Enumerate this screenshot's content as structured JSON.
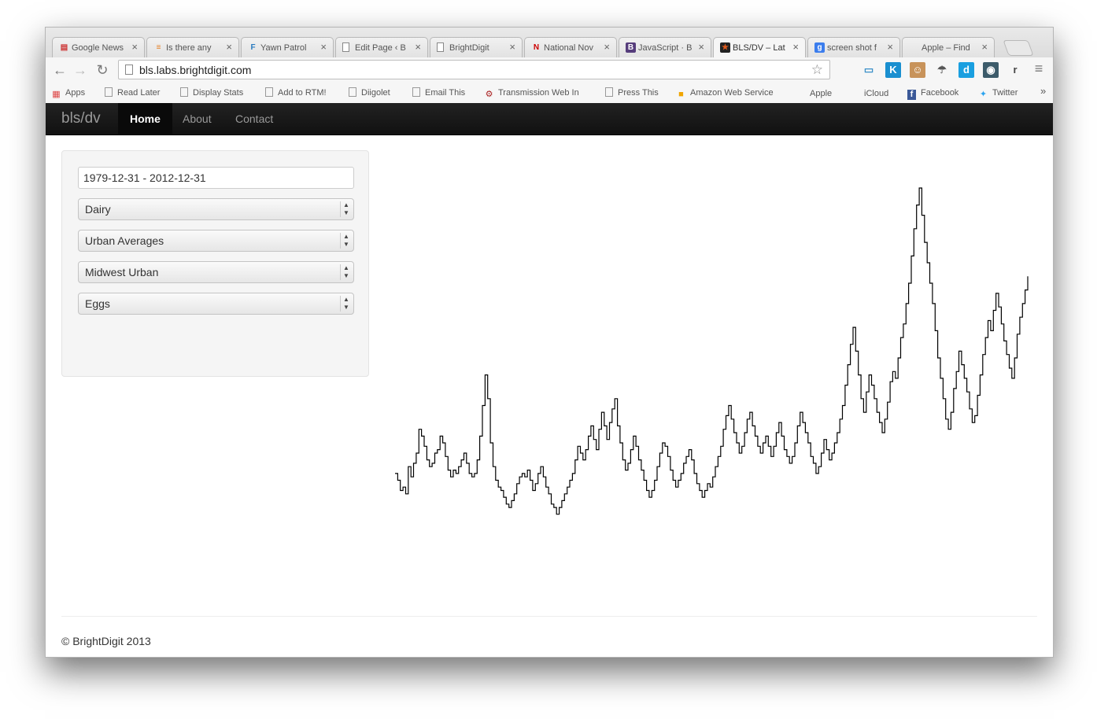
{
  "browser": {
    "tabs": [
      {
        "icon": "news-icon",
        "label": "Google News"
      },
      {
        "icon": "stackoverflow-icon",
        "label": "Is there any"
      },
      {
        "icon": "fth-icon",
        "label": "Yawn Patrol"
      },
      {
        "icon": "page-icon",
        "label": "Edit Page ‹ B"
      },
      {
        "icon": "page-icon",
        "label": "BrightDigit"
      },
      {
        "icon": "n-logo-icon",
        "label": "National Nov"
      },
      {
        "icon": "bootstrap-icon",
        "label": "JavaScript · B"
      },
      {
        "icon": "star-icon",
        "label": "BLS/DV – Lat"
      },
      {
        "icon": "google-icon",
        "label": "screen shot f"
      },
      {
        "icon": "apple-icon",
        "label": "Apple – Find"
      }
    ],
    "active_tab": 7,
    "url": "bls.labs.brightdigit.com",
    "bookmarks": [
      {
        "icon": "apps-grid-icon",
        "label": "Apps"
      },
      {
        "icon": "page-icon",
        "label": "Read Later"
      },
      {
        "icon": "page-icon",
        "label": "Display Stats"
      },
      {
        "icon": "page-icon",
        "label": "Add to RTM!"
      },
      {
        "icon": "page-icon",
        "label": "Diigolet"
      },
      {
        "icon": "page-icon",
        "label": "Email This"
      },
      {
        "icon": "transmission-icon",
        "label": "Transmission Web In"
      },
      {
        "icon": "page-icon",
        "label": "Press This"
      },
      {
        "icon": "amazon-icon",
        "label": "Amazon Web Service"
      },
      {
        "icon": "apple-icon",
        "label": "Apple"
      },
      {
        "icon": "apple-icon",
        "label": "iCloud"
      },
      {
        "icon": "facebook-icon",
        "label": "Facebook"
      },
      {
        "icon": "twitter-icon",
        "label": "Twitter"
      }
    ],
    "bookmarks_overflow": "»",
    "extensions": [
      {
        "name": "cast-icon",
        "glyph": "▭"
      },
      {
        "name": "k-extension-icon",
        "glyph": "K"
      },
      {
        "name": "character-extension-icon",
        "glyph": "☺"
      },
      {
        "name": "umbrella-extension-icon",
        "glyph": "☂"
      },
      {
        "name": "d-extension-icon",
        "glyph": "d"
      },
      {
        "name": "owl-extension-icon",
        "glyph": "◉"
      },
      {
        "name": "r-extension-icon",
        "glyph": "r"
      }
    ]
  },
  "site": {
    "brand": "bls/dv",
    "nav": [
      {
        "label": "Home",
        "active": true
      },
      {
        "label": "About",
        "active": false
      },
      {
        "label": "Contact",
        "active": false
      }
    ],
    "form": {
      "date_range": "1979-12-31 - 2012-12-31",
      "category": "Dairy",
      "area_type": "Urban Averages",
      "area": "Midwest Urban",
      "item": "Eggs"
    },
    "footer": "© BrightDigit 2013"
  },
  "colors": {
    "navbar": "#111111",
    "line": "#000000",
    "well": "#f5f5f5"
  },
  "chart_data": {
    "type": "line",
    "step": true,
    "x_start": "1979-12-31",
    "x_end": "2012-12-31",
    "frequency": "monthly",
    "note_units": "values read as relative index (unlabeled axes)",
    "y": [
      0.16,
      0.14,
      0.11,
      0.12,
      0.1,
      0.18,
      0.15,
      0.19,
      0.22,
      0.29,
      0.27,
      0.24,
      0.2,
      0.18,
      0.19,
      0.22,
      0.23,
      0.27,
      0.25,
      0.21,
      0.17,
      0.15,
      0.17,
      0.16,
      0.18,
      0.2,
      0.22,
      0.19,
      0.16,
      0.15,
      0.16,
      0.2,
      0.27,
      0.36,
      0.45,
      0.38,
      0.25,
      0.18,
      0.14,
      0.12,
      0.11,
      0.09,
      0.07,
      0.06,
      0.08,
      0.1,
      0.13,
      0.15,
      0.16,
      0.15,
      0.17,
      0.14,
      0.11,
      0.13,
      0.16,
      0.18,
      0.15,
      0.12,
      0.1,
      0.07,
      0.06,
      0.04,
      0.06,
      0.08,
      0.1,
      0.12,
      0.14,
      0.16,
      0.2,
      0.24,
      0.22,
      0.2,
      0.23,
      0.27,
      0.3,
      0.26,
      0.23,
      0.29,
      0.34,
      0.3,
      0.26,
      0.31,
      0.35,
      0.38,
      0.3,
      0.25,
      0.2,
      0.17,
      0.19,
      0.23,
      0.27,
      0.24,
      0.2,
      0.17,
      0.14,
      0.11,
      0.09,
      0.11,
      0.14,
      0.18,
      0.22,
      0.25,
      0.24,
      0.21,
      0.17,
      0.14,
      0.12,
      0.14,
      0.16,
      0.19,
      0.21,
      0.23,
      0.2,
      0.16,
      0.13,
      0.11,
      0.09,
      0.11,
      0.13,
      0.12,
      0.15,
      0.18,
      0.21,
      0.24,
      0.29,
      0.33,
      0.36,
      0.32,
      0.28,
      0.25,
      0.22,
      0.24,
      0.28,
      0.32,
      0.34,
      0.3,
      0.27,
      0.24,
      0.22,
      0.25,
      0.27,
      0.24,
      0.21,
      0.24,
      0.28,
      0.31,
      0.27,
      0.23,
      0.21,
      0.19,
      0.21,
      0.25,
      0.3,
      0.34,
      0.31,
      0.28,
      0.25,
      0.21,
      0.19,
      0.16,
      0.18,
      0.22,
      0.26,
      0.23,
      0.2,
      0.22,
      0.25,
      0.28,
      0.32,
      0.36,
      0.42,
      0.48,
      0.54,
      0.59,
      0.52,
      0.45,
      0.38,
      0.34,
      0.4,
      0.45,
      0.42,
      0.38,
      0.34,
      0.31,
      0.28,
      0.32,
      0.37,
      0.43,
      0.46,
      0.44,
      0.5,
      0.56,
      0.6,
      0.66,
      0.72,
      0.8,
      0.88,
      0.95,
      1.0,
      0.92,
      0.84,
      0.78,
      0.72,
      0.66,
      0.58,
      0.5,
      0.44,
      0.38,
      0.32,
      0.29,
      0.34,
      0.41,
      0.46,
      0.52,
      0.48,
      0.44,
      0.4,
      0.35,
      0.31,
      0.33,
      0.39,
      0.45,
      0.51,
      0.56,
      0.61,
      0.58,
      0.64,
      0.69,
      0.65,
      0.6,
      0.55,
      0.51,
      0.47,
      0.44,
      0.5,
      0.57,
      0.62,
      0.66,
      0.7,
      0.74
    ]
  }
}
